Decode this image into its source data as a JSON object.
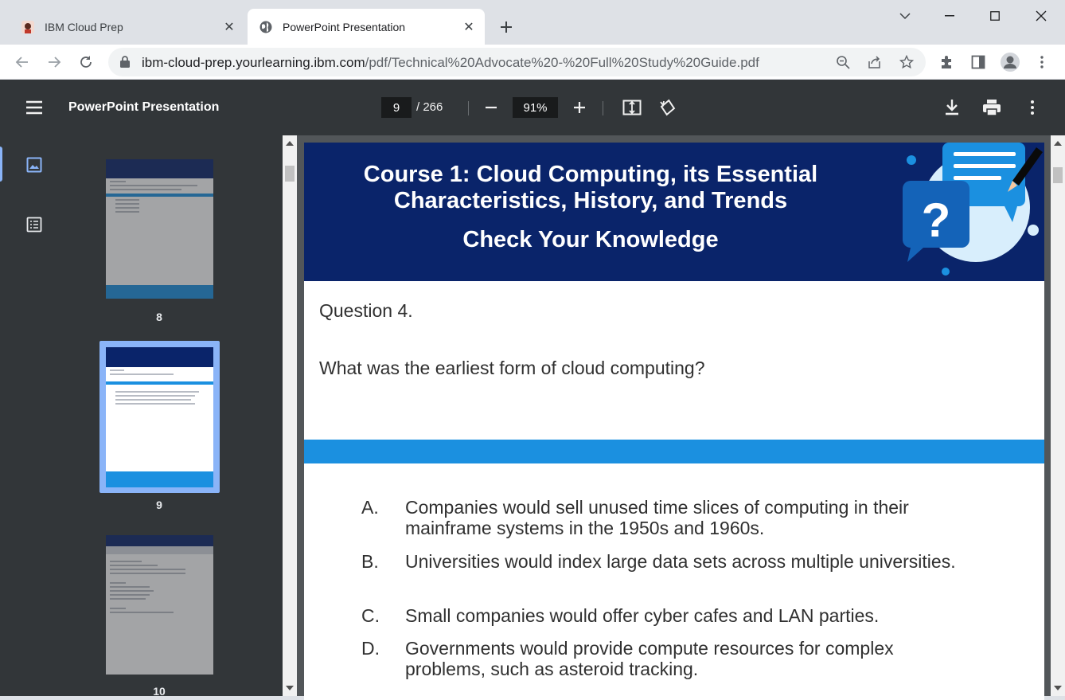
{
  "browser": {
    "tabs": [
      {
        "title": "IBM Cloud Prep",
        "active": false
      },
      {
        "title": "PowerPoint Presentation",
        "active": true
      }
    ],
    "url_host": "ibm-cloud-prep.yourlearning.ibm.com",
    "url_path": "/pdf/Technical%20Advocate%20-%20Full%20Study%20Guide.pdf"
  },
  "viewer": {
    "title": "PowerPoint Presentation",
    "current_page": "9",
    "total_pages": "/ 266",
    "zoom": "91%"
  },
  "thumbnails": [
    {
      "page": "8",
      "selected": false
    },
    {
      "page": "9",
      "selected": true
    },
    {
      "page": "10",
      "selected": false
    }
  ],
  "slide": {
    "heading_line1": "Course 1: Cloud Computing, its Essential",
    "heading_line2": "Characteristics, History, and Trends",
    "subheading": "Check Your Knowledge",
    "question_label": "Question 4.",
    "question": "What was the earliest form of cloud computing?",
    "options": [
      {
        "letter": "A.",
        "text": "Companies would sell unused time slices of computing in their mainframe systems in the 1950s and 1960s."
      },
      {
        "letter": "B.",
        "text": "Universities would index large data sets across multiple universities."
      },
      {
        "letter": "C.",
        "text": "Small companies would offer cyber cafes and LAN parties."
      },
      {
        "letter": "D.",
        "text": "Governments would provide compute resources for complex problems, such as asteroid tracking."
      }
    ]
  },
  "colors": {
    "slide_header": "#0a246a",
    "accent_band": "#1b90e0",
    "viewer_bar": "#323639",
    "selection": "#8ab4f8"
  }
}
